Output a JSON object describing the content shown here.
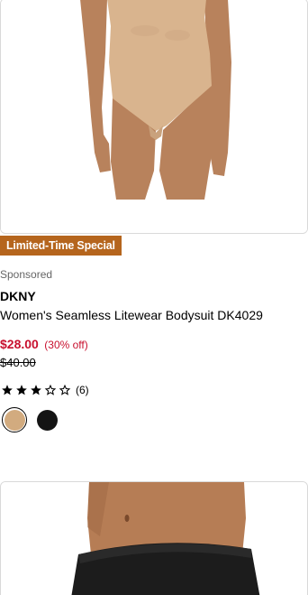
{
  "products": [
    {
      "image_alt": "product-photo-bodysuit",
      "promo_badge": "Limited-Time Special",
      "sponsored": "Sponsored",
      "brand": "DKNY",
      "name": "Women's Seamless Litewear Bodysuit DK4029",
      "sale_price": "$28.00",
      "discount": "(30% off)",
      "original_price": "$40.00",
      "rating": 3,
      "rating_max": 5,
      "review_count": "(6)",
      "swatches": [
        {
          "color": "#d2ab7f",
          "selected": true
        },
        {
          "color": "#141414",
          "selected": false
        }
      ]
    },
    {
      "image_alt": "product-photo-brief"
    }
  ],
  "colors": {
    "promo_badge_bg": "#b5651d",
    "sale_red": "#c8102e",
    "muted_gray": "#666666"
  },
  "icons": {
    "star_filled": "star-filled-icon",
    "star_empty": "star-empty-icon"
  }
}
